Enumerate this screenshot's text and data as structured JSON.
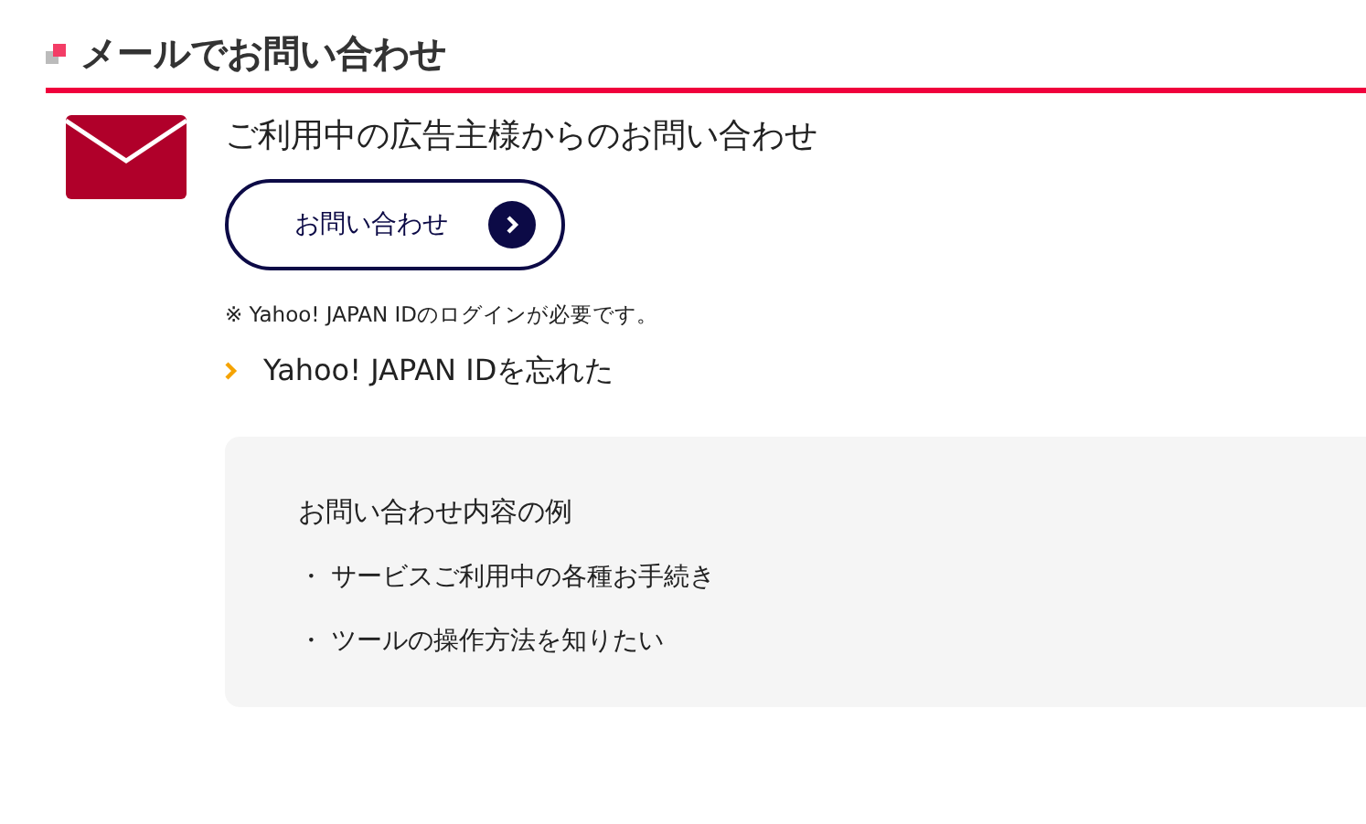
{
  "section_title": "メールでお問い合わせ",
  "contact": {
    "title": "ご利用中の広告主様からのお問い合わせ",
    "button": "お問い合わせ",
    "note": "※ Yahoo! JAPAN IDのログインが必要です。",
    "link": "Yahoo! JAPAN IDを忘れた"
  },
  "examples": {
    "title": "お問い合わせ内容の例",
    "items": [
      {
        "marker": "・",
        "text": "サービスご利用中の各種お手続き"
      },
      {
        "marker": "・",
        "text": "ツールの操作方法を知りたい"
      }
    ]
  }
}
